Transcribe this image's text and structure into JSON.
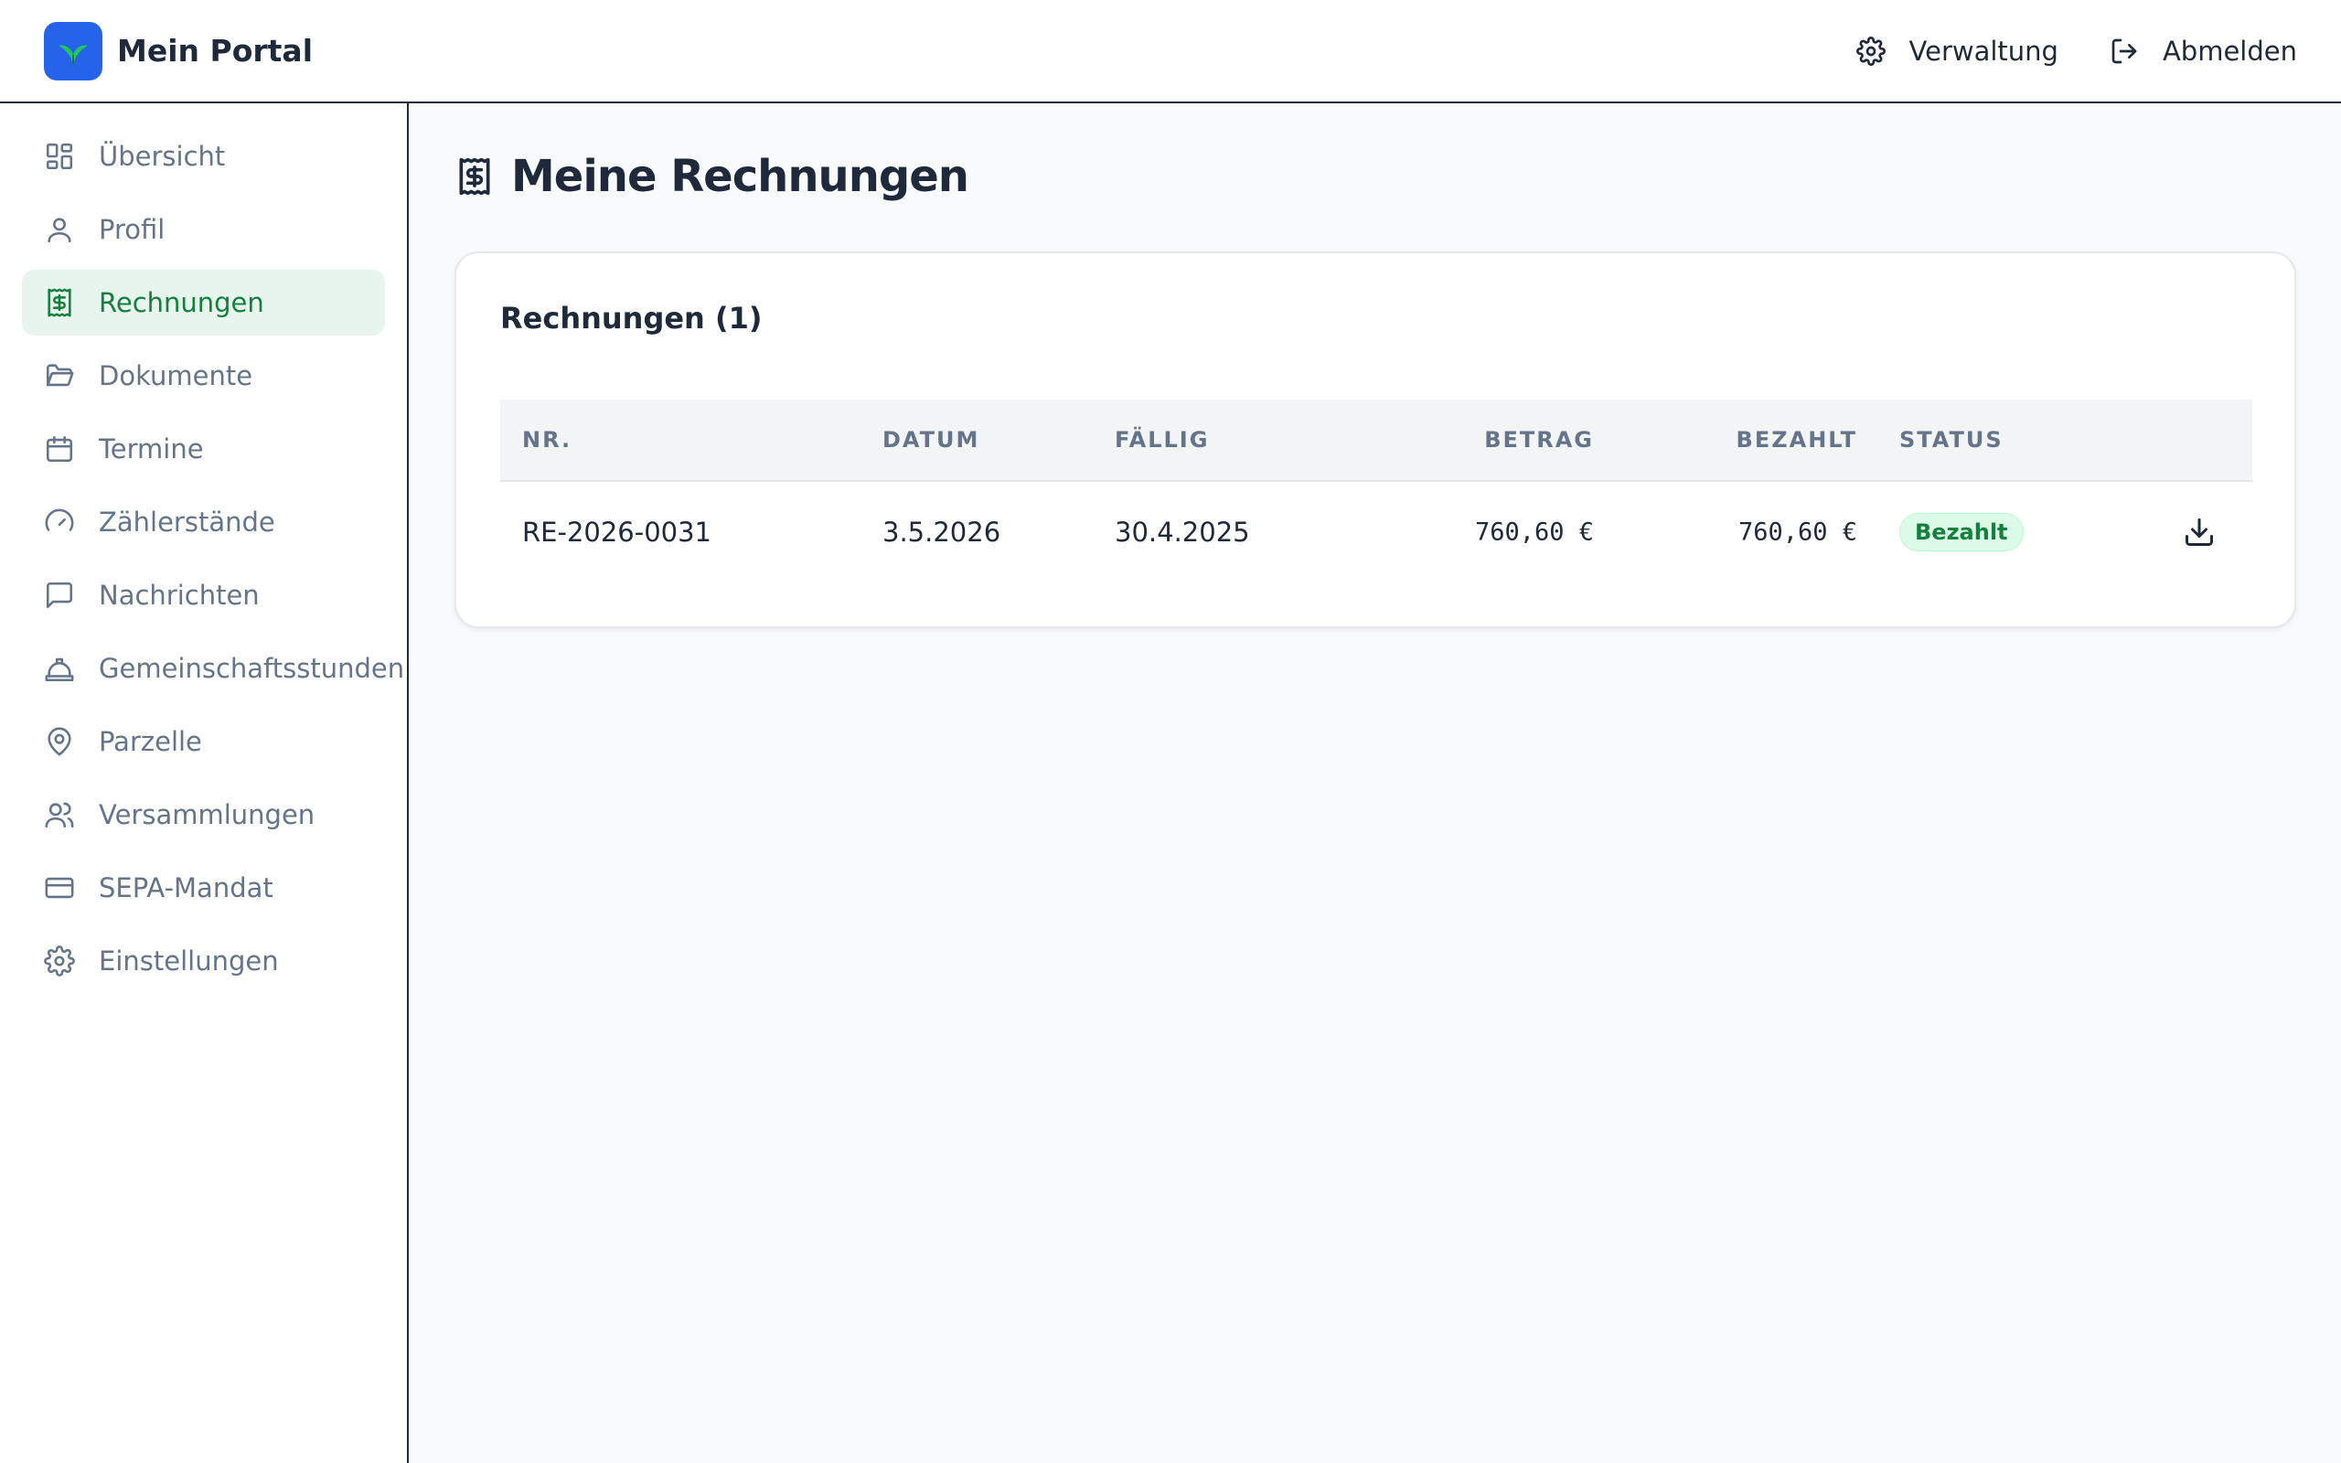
{
  "brand": {
    "title": "Mein Portal"
  },
  "top_actions": {
    "admin": "Verwaltung",
    "logout": "Abmelden"
  },
  "sidebar": {
    "items": [
      {
        "label": "Übersicht",
        "icon": "dashboard-icon"
      },
      {
        "label": "Profil",
        "icon": "user-icon"
      },
      {
        "label": "Rechnungen",
        "icon": "receipt-icon",
        "active": true
      },
      {
        "label": "Dokumente",
        "icon": "folder-icon"
      },
      {
        "label": "Termine",
        "icon": "calendar-icon"
      },
      {
        "label": "Zählerstände",
        "icon": "gauge-icon"
      },
      {
        "label": "Nachrichten",
        "icon": "message-icon"
      },
      {
        "label": "Gemeinschaftsstunden",
        "icon": "hardhat-icon"
      },
      {
        "label": "Parzelle",
        "icon": "map-pin-icon"
      },
      {
        "label": "Versammlungen",
        "icon": "users-icon"
      },
      {
        "label": "SEPA-Mandat",
        "icon": "credit-card-icon"
      },
      {
        "label": "Einstellungen",
        "icon": "gear-icon"
      }
    ]
  },
  "page": {
    "title": "Meine Rechnungen"
  },
  "invoices": {
    "card_title": "Rechnungen (1)",
    "columns": [
      "NR.",
      "DATUM",
      "FÄLLIG",
      "BETRAG",
      "BEZAHLT",
      "STATUS"
    ],
    "rows": [
      {
        "nr": "RE-2026-0031",
        "datum": "3.5.2026",
        "faellig": "30.4.2025",
        "betrag": "760,60 €",
        "bezahlt": "760,60 €",
        "status": "Bezahlt"
      }
    ]
  },
  "colors": {
    "accent": "#15803d",
    "active_bg": "#e8f5ee",
    "logo": "#2563eb"
  }
}
